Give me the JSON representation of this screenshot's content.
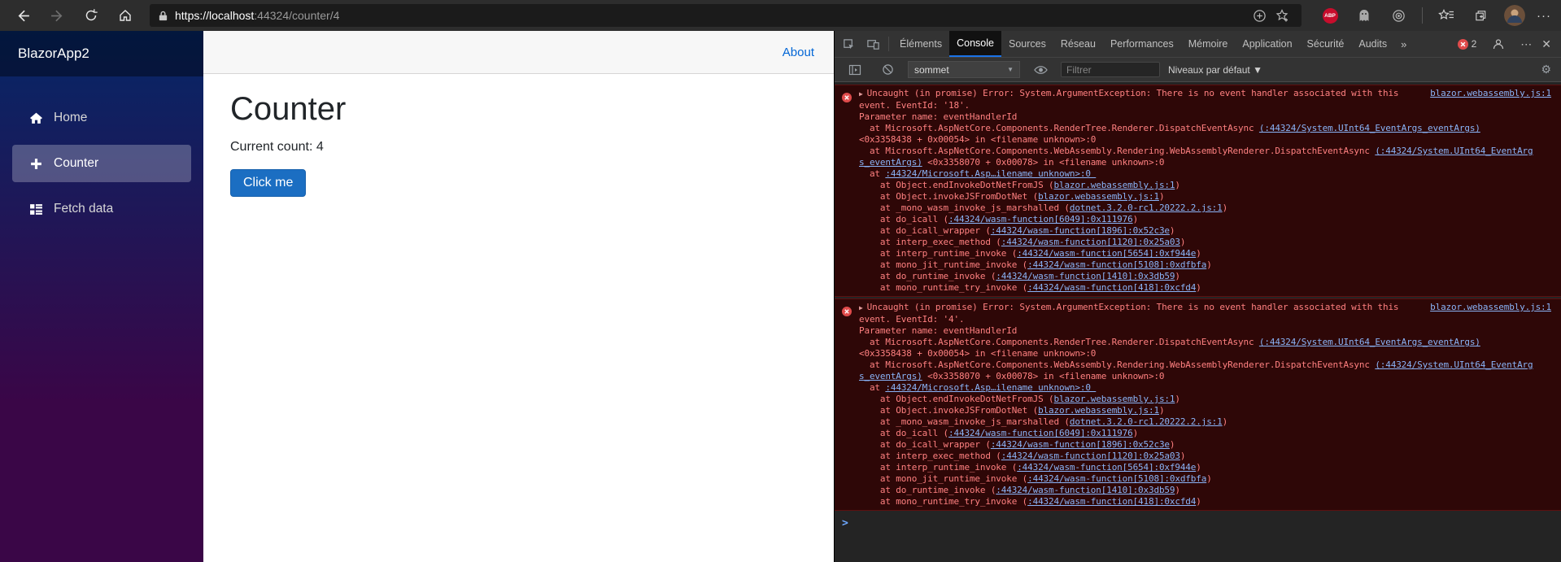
{
  "browser": {
    "url_host": "https://localhost",
    "url_path": ":44324/counter/4",
    "abp_badge": "ABP",
    "menu_dots": "···"
  },
  "app": {
    "brand": "BlazorApp2",
    "nav": [
      {
        "label": "Home",
        "icon": "home-icon",
        "active": false
      },
      {
        "label": "Counter",
        "icon": "plus-icon",
        "active": true
      },
      {
        "label": "Fetch data",
        "icon": "list-icon",
        "active": false
      }
    ],
    "about_label": "About",
    "main": {
      "title": "Counter",
      "count_text": "Current count: 4",
      "button_label": "Click me"
    }
  },
  "devtools": {
    "tabs": [
      {
        "label": "Éléments",
        "selected": false
      },
      {
        "label": "Console",
        "selected": true
      },
      {
        "label": "Sources",
        "selected": false
      },
      {
        "label": "Réseau",
        "selected": false
      },
      {
        "label": "Performances",
        "selected": false
      },
      {
        "label": "Mémoire",
        "selected": false
      },
      {
        "label": "Application",
        "selected": false
      },
      {
        "label": "Sécurité",
        "selected": false
      },
      {
        "label": "Audits",
        "selected": false
      }
    ],
    "more_tabs": "»",
    "error_count": "2",
    "overflow_dots": "⋯",
    "close_glyph": "✕",
    "toolbar": {
      "context_selector": "sommet",
      "caret": "▼",
      "filter_placeholder": "Filtrer",
      "levels_label": "Niveaux par défaut ▼",
      "gear_glyph": "⚙"
    },
    "console": {
      "prompt": ">",
      "expand_glyph": "▶",
      "blocks": [
        {
          "lines": [
            {
              "right_link": "blazor.webassembly.js:1",
              "segs": [
                [
                  "Uncaught (in promise) Error: System.ArgumentException: There is no event handler associated with this",
                  0
                ]
              ]
            },
            {
              "segs": [
                [
                  "event. EventId: '18'.",
                  0
                ]
              ]
            },
            {
              "segs": [
                [
                  "Parameter name: eventHandlerId",
                  0
                ]
              ]
            },
            {
              "segs": [
                [
                  "  at Microsoft.AspNetCore.Components.RenderTree.Renderer.DispatchEventAsync ",
                  0
                ],
                [
                  "(:44324/System.UInt64_EventArgs_eventArgs)",
                  1
                ]
              ]
            },
            {
              "segs": [
                [
                  "<0x3358438 + 0x00054> in <filename unknown>:0",
                  0
                ]
              ]
            },
            {
              "segs": [
                [
                  "  at Microsoft.AspNetCore.Components.WebAssembly.Rendering.WebAssemblyRenderer.DispatchEventAsync ",
                  0
                ],
                [
                  "(:44324/System.UInt64_EventArg",
                  1
                ]
              ]
            },
            {
              "segs": [
                [
                  "s_eventArgs)",
                  1
                ],
                [
                  " <0x3358070 + 0x00078> in <filename unknown>:0",
                  0
                ]
              ]
            },
            {
              "segs": [
                [
                  "  at ",
                  0
                ],
                [
                  ":44324/Microsoft.Asp…ilename unknown>:0 ",
                  1
                ]
              ]
            },
            {
              "segs": [
                [
                  "    at Object.endInvokeDotNetFromJS (",
                  0
                ],
                [
                  "blazor.webassembly.js:1",
                  1
                ],
                [
                  ")",
                  0
                ]
              ]
            },
            {
              "segs": [
                [
                  "    at Object.invokeJSFromDotNet (",
                  0
                ],
                [
                  "blazor.webassembly.js:1",
                  1
                ],
                [
                  ")",
                  0
                ]
              ]
            },
            {
              "segs": [
                [
                  "    at _mono_wasm_invoke_js_marshalled (",
                  0
                ],
                [
                  "dotnet.3.2.0-rc1.20222.2.js:1",
                  1
                ],
                [
                  ")",
                  0
                ]
              ]
            },
            {
              "segs": [
                [
                  "    at do_icall (",
                  0
                ],
                [
                  ":44324/wasm-function[6049]:0x111976",
                  1
                ],
                [
                  ")",
                  0
                ]
              ]
            },
            {
              "segs": [
                [
                  "    at do_icall_wrapper (",
                  0
                ],
                [
                  ":44324/wasm-function[1896]:0x52c3e",
                  1
                ],
                [
                  ")",
                  0
                ]
              ]
            },
            {
              "segs": [
                [
                  "    at interp_exec_method (",
                  0
                ],
                [
                  ":44324/wasm-function[1120]:0x25a03",
                  1
                ],
                [
                  ")",
                  0
                ]
              ]
            },
            {
              "segs": [
                [
                  "    at interp_runtime_invoke (",
                  0
                ],
                [
                  ":44324/wasm-function[5654]:0xf944e",
                  1
                ],
                [
                  ")",
                  0
                ]
              ]
            },
            {
              "segs": [
                [
                  "    at mono_jit_runtime_invoke (",
                  0
                ],
                [
                  ":44324/wasm-function[5108]:0xdfbfa",
                  1
                ],
                [
                  ")",
                  0
                ]
              ]
            },
            {
              "segs": [
                [
                  "    at do_runtime_invoke (",
                  0
                ],
                [
                  ":44324/wasm-function[1410]:0x3db59",
                  1
                ],
                [
                  ")",
                  0
                ]
              ]
            },
            {
              "segs": [
                [
                  "    at mono_runtime_try_invoke (",
                  0
                ],
                [
                  ":44324/wasm-function[418]:0xcfd4",
                  1
                ],
                [
                  ")",
                  0
                ]
              ]
            }
          ]
        },
        {
          "lines": [
            {
              "right_link": "blazor.webassembly.js:1",
              "segs": [
                [
                  "Uncaught (in promise) Error: System.ArgumentException: There is no event handler associated with this",
                  0
                ]
              ]
            },
            {
              "segs": [
                [
                  "event. EventId: '4'.",
                  0
                ]
              ]
            },
            {
              "segs": [
                [
                  "Parameter name: eventHandlerId",
                  0
                ]
              ]
            },
            {
              "segs": [
                [
                  "  at Microsoft.AspNetCore.Components.RenderTree.Renderer.DispatchEventAsync ",
                  0
                ],
                [
                  "(:44324/System.UInt64_EventArgs_eventArgs)",
                  1
                ]
              ]
            },
            {
              "segs": [
                [
                  "<0x3358438 + 0x00054> in <filename unknown>:0",
                  0
                ]
              ]
            },
            {
              "segs": [
                [
                  "  at Microsoft.AspNetCore.Components.WebAssembly.Rendering.WebAssemblyRenderer.DispatchEventAsync ",
                  0
                ],
                [
                  "(:44324/System.UInt64_EventArg",
                  1
                ]
              ]
            },
            {
              "segs": [
                [
                  "s_eventArgs)",
                  1
                ],
                [
                  " <0x3358070 + 0x00078> in <filename unknown>:0",
                  0
                ]
              ]
            },
            {
              "segs": [
                [
                  "  at ",
                  0
                ],
                [
                  ":44324/Microsoft.Asp…ilename unknown>:0 ",
                  1
                ]
              ]
            },
            {
              "segs": [
                [
                  "    at Object.endInvokeDotNetFromJS (",
                  0
                ],
                [
                  "blazor.webassembly.js:1",
                  1
                ],
                [
                  ")",
                  0
                ]
              ]
            },
            {
              "segs": [
                [
                  "    at Object.invokeJSFromDotNet (",
                  0
                ],
                [
                  "blazor.webassembly.js:1",
                  1
                ],
                [
                  ")",
                  0
                ]
              ]
            },
            {
              "segs": [
                [
                  "    at _mono_wasm_invoke_js_marshalled (",
                  0
                ],
                [
                  "dotnet.3.2.0-rc1.20222.2.js:1",
                  1
                ],
                [
                  ")",
                  0
                ]
              ]
            },
            {
              "segs": [
                [
                  "    at do_icall (",
                  0
                ],
                [
                  ":44324/wasm-function[6049]:0x111976",
                  1
                ],
                [
                  ")",
                  0
                ]
              ]
            },
            {
              "segs": [
                [
                  "    at do_icall_wrapper (",
                  0
                ],
                [
                  ":44324/wasm-function[1896]:0x52c3e",
                  1
                ],
                [
                  ")",
                  0
                ]
              ]
            },
            {
              "segs": [
                [
                  "    at interp_exec_method (",
                  0
                ],
                [
                  ":44324/wasm-function[1120]:0x25a03",
                  1
                ],
                [
                  ")",
                  0
                ]
              ]
            },
            {
              "segs": [
                [
                  "    at interp_runtime_invoke (",
                  0
                ],
                [
                  ":44324/wasm-function[5654]:0xf944e",
                  1
                ],
                [
                  ")",
                  0
                ]
              ]
            },
            {
              "segs": [
                [
                  "    at mono_jit_runtime_invoke (",
                  0
                ],
                [
                  ":44324/wasm-function[5108]:0xdfbfa",
                  1
                ],
                [
                  ")",
                  0
                ]
              ]
            },
            {
              "segs": [
                [
                  "    at do_runtime_invoke (",
                  0
                ],
                [
                  ":44324/wasm-function[1410]:0x3db59",
                  1
                ],
                [
                  ")",
                  0
                ]
              ]
            },
            {
              "segs": [
                [
                  "    at mono_runtime_try_invoke (",
                  0
                ],
                [
                  ":44324/wasm-function[418]:0xcfd4",
                  1
                ],
                [
                  ")",
                  0
                ]
              ]
            }
          ]
        }
      ]
    }
  },
  "colors": {
    "accent_blue": "#1a73e8",
    "link_blue": "#8ab4f8",
    "error_text": "#ff8080",
    "error_bg": "#2e0707",
    "error_border": "#5c1010",
    "button_blue": "#1b6ec2",
    "sidebar_gradient_top": "#052767",
    "sidebar_gradient_bottom": "#3a0647",
    "abp_red": "#c70d2c"
  },
  "icons": {
    "gear-icon": "⚙",
    "dropdown-caret-icon": "▼",
    "more-tabs-icon": "»",
    "overflow-menu-icon": "⋯",
    "close-icon": "✕",
    "expand-caret-icon": "▶",
    "console-prompt-icon": ">",
    "browser-menu-icon": "···"
  }
}
